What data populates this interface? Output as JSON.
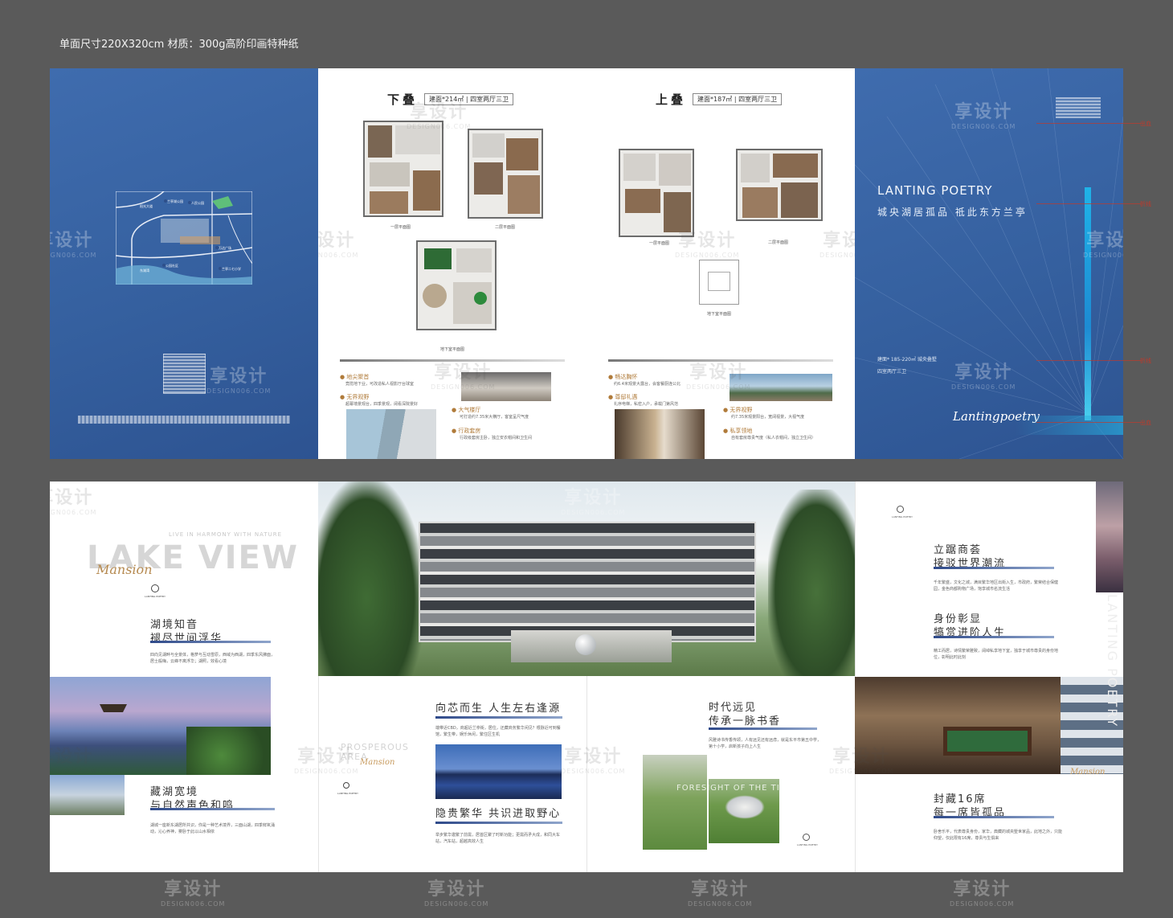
{
  "spec": "单面尺寸220X320cm  材质：300g高阶印画特种纸",
  "watermark": {
    "brand": "享设计",
    "site": "DESIGN006.COM"
  },
  "lower_plan": {
    "title": "下叠",
    "tag": "建面*214㎡  |  四室两厅三卫",
    "caption_1f": "一层平面图",
    "caption_2f": "二层平面图",
    "caption_b": "地下室平面图",
    "features": [
      {
        "title": "● 地尖聚首",
        "desc": "竟揽地下业，可改造私人视影厅台球室"
      },
      {
        "title": "● 大气楼厅",
        "desc": "可打造约7.35米大横厅，客室呈尺气度"
      },
      {
        "title": "● 无界观野",
        "desc": "超幕墙景观台，四季景观，阔看深院景好"
      },
      {
        "title": "● 行政套房",
        "desc": "行政级套房主卧，独立安衣帽间和卫生间"
      }
    ]
  },
  "upper_plan": {
    "title": "上叠",
    "tag": "建面*187㎡  |  四室两厅三卫",
    "caption_1f": "一层平面图",
    "caption_2f": "二层平面图",
    "caption_b": "地下室平面图",
    "features": [
      {
        "title": "● 畅达胸怀",
        "desc": "约6.4米观景大露台，会客餐厨连公北"
      },
      {
        "title": "● 尊邸礼遇",
        "desc": "礼序电梯，私密入户，承载门第风范"
      },
      {
        "title": "● 无界视野",
        "desc": "约7.35米观景阳台，宽阔视景，大视气度"
      },
      {
        "title": "● 私享领地",
        "desc": "自有套房尊贵气度（私人衣帽间，独立卫生间）"
      }
    ]
  },
  "cover": {
    "brand": "LANTING POETRY",
    "slogan": "城央湖居孤品  祗此东方兰亭",
    "area": "建面* 185-220㎡ 城央叠墅",
    "layout": "四室两厅三卫",
    "signature": "Lantingpoetry"
  },
  "map": {
    "labels": [
      "兰亭湖公园",
      "阳光大道",
      "人民公园",
      "东湖湾",
      "万达广场",
      "公园社区",
      "兰亭二七小学"
    ]
  },
  "lake_view": {
    "small": "LIVE IN HARMONY WITH NATURE",
    "big": "LAKE VIEW",
    "script": "Mansion",
    "logo_text": "LANTING POETRY",
    "h1a": "湖境知音",
    "h1b": "褪尽世间浮华",
    "d1": "四向见湖畔与全景体，格萝与互动雪原，西域为西湖，四季东风拂面，居士般梅，云峰不离浮华；湖照，效看心境",
    "h2a": "藏湖宽境",
    "h2b": "与自然声色和鸣",
    "d2": "湖城一座新东湖居所共识，你是一种艺术境界，三面山湖，四季鲜氧涌动，沁心养神，雾卧于此以山水相依"
  },
  "city": {
    "h1": "向芯而生 人生左右逢源",
    "d1": "端带近CBD，商超近兰亭街，居住，还藏商务繁华闲见？根脉近可到餐馆，繁生带，娱乐休闲，繁住区生机",
    "en": "PROSPEROUS AREA",
    "script": "Mansion",
    "logo_text": "LANTING POETRY",
    "h2": "隐贵繁华 共识进取野心",
    "d2": "举步繁华邀繁了前需，居首区聚了时新功能；更需而矛大成，和同大车站，汽车站，超越高效人生"
  },
  "edu": {
    "h1": "时代远见",
    "h2": "传承一脉书香",
    "d1": "风雅诗书传香传颂，人有远见还有远虑，就是东平市第五中学，第十小学，启新孩子向上人生",
    "en": "FORESIGHT OF THE TIMES",
    "logo_text": "LANTING POETRY"
  },
  "business": {
    "logo_text": "LANTING POETRY",
    "h1a": "立踞商荟",
    "h1b": "接驳世界潮流",
    "d1": "千年繁盛，文化之城，满目繁华地区出街入生，市政府，繁荣结合保健园，金色商都购物广场，饱享城市名流生活",
    "h2a": "身份彰显",
    "h2b": "犒赏进阶人生",
    "d2": "精工而居，诗情繁荣雅致，阔绰私享地下室，独享于城市尊贵的身份地位，彰明此时此刻",
    "h3a": "封藏16席",
    "h3b": "每一席皆孤品",
    "d3": "卧舍乐平，代表尊贵身份，家华，典藏的城央墅世家品，此地之外，只能仰望，仅此限有16席，尊贵与生俱来",
    "script": "Mansion",
    "vertical": "LANTING POETRY"
  },
  "marks": [
    "出血",
    "折线",
    "折线",
    "出血"
  ],
  "colors": {
    "cover_blue": "#3b67a8",
    "accent_gold": "#b07b3a",
    "bg": "#5a5a5a"
  }
}
